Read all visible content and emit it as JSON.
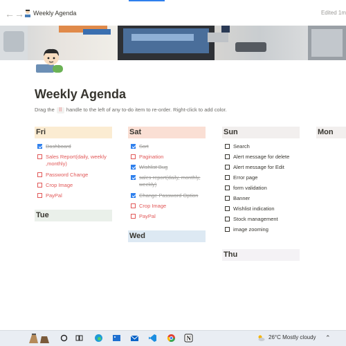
{
  "browser": {
    "back_icon": "arrow-left-icon",
    "forward_icon": "arrow-right-icon",
    "accent_color": "#2f80ed"
  },
  "breadcrumb": {
    "title": "Weekly Agenda",
    "edited": "Edited 1m"
  },
  "page": {
    "title": "Weekly Agenda",
    "hint_before": "Drag the",
    "hint_key": "⠿",
    "hint_after": "handle to the left of any to-do item to re-order. Right-click to add color."
  },
  "colors": {
    "fri": "#fbecd2",
    "sat": "#fadfd4",
    "sun": "#f2efee",
    "mon": "#f2efee",
    "tue": "#eaf0ea",
    "wed": "#dde9f3",
    "thu": "#f4f2f5",
    "red_text": "#e15757",
    "check_blue": "#2f80ed"
  },
  "columns": [
    {
      "day": "Fri",
      "items": [
        {
          "label": "Dashboard",
          "checked": true
        },
        {
          "label": "Sales Report(daily, weekly ,monthly)",
          "checked": false
        },
        {
          "label": "Password Change",
          "checked": false
        },
        {
          "label": "Crop Image",
          "checked": false
        },
        {
          "label": "PayPal",
          "checked": false
        }
      ],
      "second_day": "Tue"
    },
    {
      "day": "Sat",
      "items": [
        {
          "label": "Sort",
          "checked": true
        },
        {
          "label": "Pagination",
          "checked": false
        },
        {
          "label": "Wishlist Bug",
          "checked": true
        },
        {
          "label": "sales report(daily, monthly, weekly)",
          "checked": true
        },
        {
          "label": "Change Password Option",
          "checked": true
        },
        {
          "label": "Crop Image",
          "checked": false
        },
        {
          "label": "PayPal",
          "checked": false
        }
      ],
      "second_day": "Wed"
    },
    {
      "day": "Sun",
      "items": [
        {
          "label": "Search",
          "checked": false
        },
        {
          "label": "Alert message for delete",
          "checked": false
        },
        {
          "label": "Alert message for Edit",
          "checked": false
        },
        {
          "label": "Error page",
          "checked": false
        },
        {
          "label": "form validation",
          "checked": false
        },
        {
          "label": "Banner",
          "checked": false
        },
        {
          "label": "Wishlist indication",
          "checked": false
        },
        {
          "label": "Stock management",
          "checked": false
        },
        {
          "label": "image zooming",
          "checked": false
        }
      ],
      "second_day": "Thu"
    },
    {
      "day": "Mon",
      "items": []
    }
  ],
  "taskbar": {
    "apps": [
      "start-icon",
      "search-icon",
      "task-view-icon",
      "file-explorer-icon",
      "edge-icon",
      "photos-icon",
      "mail-icon",
      "vscode-icon",
      "store-icon",
      "chrome-icon",
      "notion-icon"
    ],
    "weather": "26°C  Mostly cloudy",
    "tray_icon": "chevron-up-icon"
  }
}
